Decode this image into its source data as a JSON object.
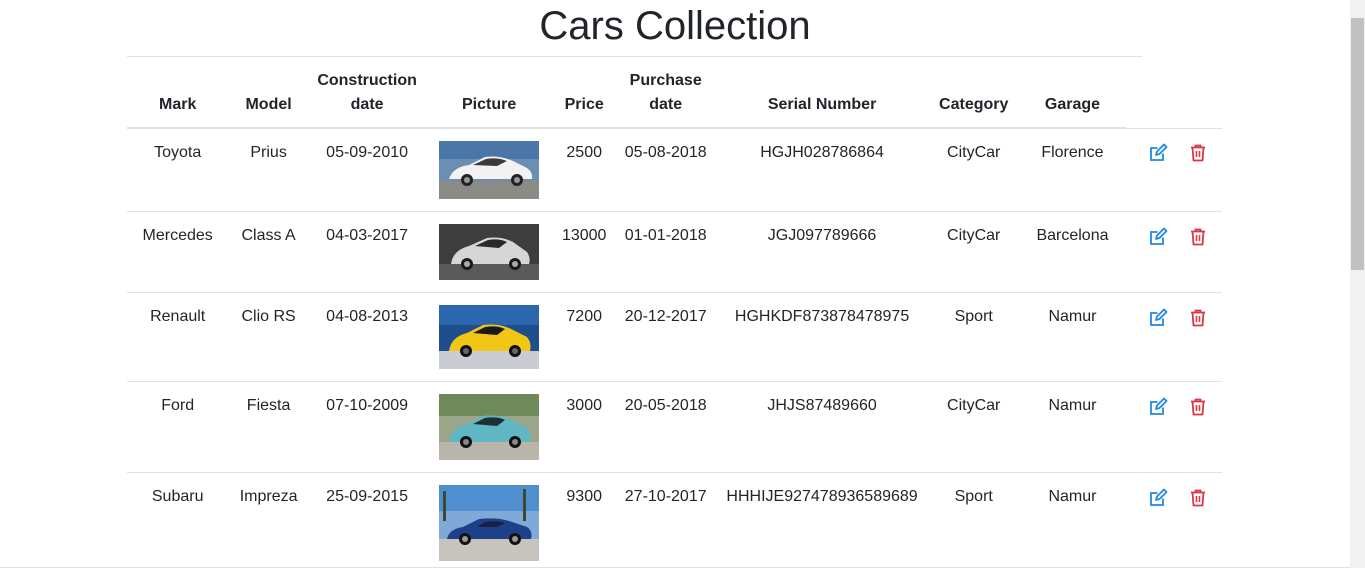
{
  "title": "Cars Collection",
  "colors": {
    "edit": "#1e88e5",
    "delete": "#dc3545",
    "border": "#dee2e6",
    "text": "#212529"
  },
  "table": {
    "headers": {
      "mark": "Mark",
      "model": "Model",
      "construction_1": "Construction",
      "construction_2": "date",
      "picture": "Picture",
      "price": "Price",
      "purchase_1": "Purchase",
      "purchase_2": "date",
      "serial": "Serial Number",
      "category": "Category",
      "garage": "Garage"
    },
    "rows": [
      {
        "mark": "Toyota",
        "model": "Prius",
        "construction_date": "05-09-2010",
        "picture": "white-hatchback-photo",
        "price": "2500",
        "purchase_date": "05-08-2018",
        "serial": "HGJH028786864",
        "category": "CityCar",
        "garage": "Florence"
      },
      {
        "mark": "Mercedes",
        "model": "Class A",
        "construction_date": "04-03-2017",
        "picture": "silver-hatchback-photo",
        "price": "13000",
        "purchase_date": "01-01-2018",
        "serial": "JGJ097789666",
        "category": "CityCar",
        "garage": "Barcelona"
      },
      {
        "mark": "Renault",
        "model": "Clio RS",
        "construction_date": "04-08-2013",
        "picture": "yellow-hatchback-photo",
        "price": "7200",
        "purchase_date": "20-12-2017",
        "serial": "HGHKDF873878478975",
        "category": "Sport",
        "garage": "Namur"
      },
      {
        "mark": "Ford",
        "model": "Fiesta",
        "construction_date": "07-10-2009",
        "picture": "teal-hatchback-photo",
        "price": "3000",
        "purchase_date": "20-05-2018",
        "serial": "JHJS87489660",
        "category": "CityCar",
        "garage": "Namur"
      },
      {
        "mark": "Subaru",
        "model": "Impreza",
        "construction_date": "25-09-2015",
        "picture": "blue-sedan-photo",
        "price": "9300",
        "purchase_date": "27-10-2017",
        "serial": "HHHIJE927478936589689",
        "category": "Sport",
        "garage": "Namur"
      }
    ],
    "row_icons": {
      "edit": "edit-icon",
      "delete": "trash-icon"
    }
  }
}
